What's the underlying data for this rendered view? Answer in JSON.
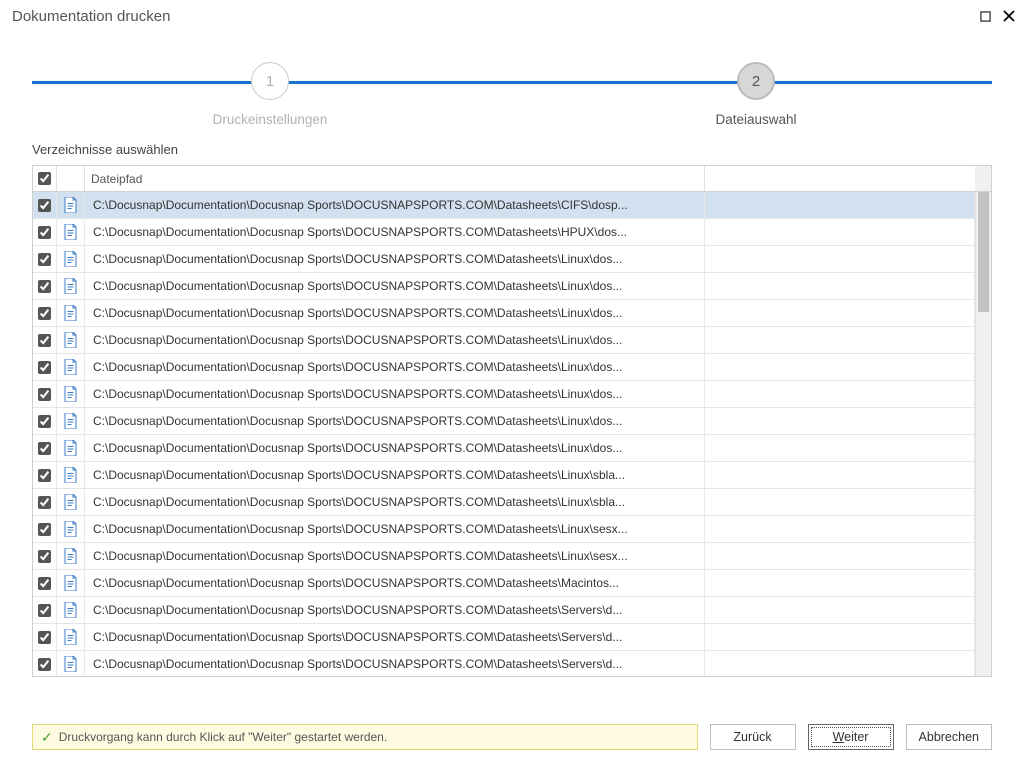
{
  "window": {
    "title": "Dokumentation drucken"
  },
  "stepper": {
    "step1_num": "1",
    "step1_label": "Druckeinstellungen",
    "step2_num": "2",
    "step2_label": "Dateiauswahl"
  },
  "section_label": "Verzeichnisse auswählen",
  "grid": {
    "header_path": "Dateipfad",
    "rows": [
      {
        "path": "C:\\Docusnap\\Documentation\\Docusnap Sports\\DOCUSNAPSPORTS.COM\\Datasheets\\CIFS\\dosp...",
        "selected": true
      },
      {
        "path": "C:\\Docusnap\\Documentation\\Docusnap Sports\\DOCUSNAPSPORTS.COM\\Datasheets\\HPUX\\dos..."
      },
      {
        "path": "C:\\Docusnap\\Documentation\\Docusnap Sports\\DOCUSNAPSPORTS.COM\\Datasheets\\Linux\\dos..."
      },
      {
        "path": "C:\\Docusnap\\Documentation\\Docusnap Sports\\DOCUSNAPSPORTS.COM\\Datasheets\\Linux\\dos..."
      },
      {
        "path": "C:\\Docusnap\\Documentation\\Docusnap Sports\\DOCUSNAPSPORTS.COM\\Datasheets\\Linux\\dos..."
      },
      {
        "path": "C:\\Docusnap\\Documentation\\Docusnap Sports\\DOCUSNAPSPORTS.COM\\Datasheets\\Linux\\dos..."
      },
      {
        "path": "C:\\Docusnap\\Documentation\\Docusnap Sports\\DOCUSNAPSPORTS.COM\\Datasheets\\Linux\\dos..."
      },
      {
        "path": "C:\\Docusnap\\Documentation\\Docusnap Sports\\DOCUSNAPSPORTS.COM\\Datasheets\\Linux\\dos..."
      },
      {
        "path": "C:\\Docusnap\\Documentation\\Docusnap Sports\\DOCUSNAPSPORTS.COM\\Datasheets\\Linux\\dos..."
      },
      {
        "path": "C:\\Docusnap\\Documentation\\Docusnap Sports\\DOCUSNAPSPORTS.COM\\Datasheets\\Linux\\dos..."
      },
      {
        "path": "C:\\Docusnap\\Documentation\\Docusnap Sports\\DOCUSNAPSPORTS.COM\\Datasheets\\Linux\\sbla..."
      },
      {
        "path": "C:\\Docusnap\\Documentation\\Docusnap Sports\\DOCUSNAPSPORTS.COM\\Datasheets\\Linux\\sbla..."
      },
      {
        "path": "C:\\Docusnap\\Documentation\\Docusnap Sports\\DOCUSNAPSPORTS.COM\\Datasheets\\Linux\\sesx..."
      },
      {
        "path": "C:\\Docusnap\\Documentation\\Docusnap Sports\\DOCUSNAPSPORTS.COM\\Datasheets\\Linux\\sesx..."
      },
      {
        "path": "C:\\Docusnap\\Documentation\\Docusnap Sports\\DOCUSNAPSPORTS.COM\\Datasheets\\Macintos..."
      },
      {
        "path": "C:\\Docusnap\\Documentation\\Docusnap Sports\\DOCUSNAPSPORTS.COM\\Datasheets\\Servers\\d..."
      },
      {
        "path": "C:\\Docusnap\\Documentation\\Docusnap Sports\\DOCUSNAPSPORTS.COM\\Datasheets\\Servers\\d..."
      },
      {
        "path": "C:\\Docusnap\\Documentation\\Docusnap Sports\\DOCUSNAPSPORTS.COM\\Datasheets\\Servers\\d..."
      }
    ]
  },
  "status": {
    "text": "Druckvorgang kann durch Klick auf \"Weiter\" gestartet werden."
  },
  "buttons": {
    "back": "Zurück",
    "next_prefix": "W",
    "next_rest": "eiter",
    "cancel": "Abbrechen"
  }
}
